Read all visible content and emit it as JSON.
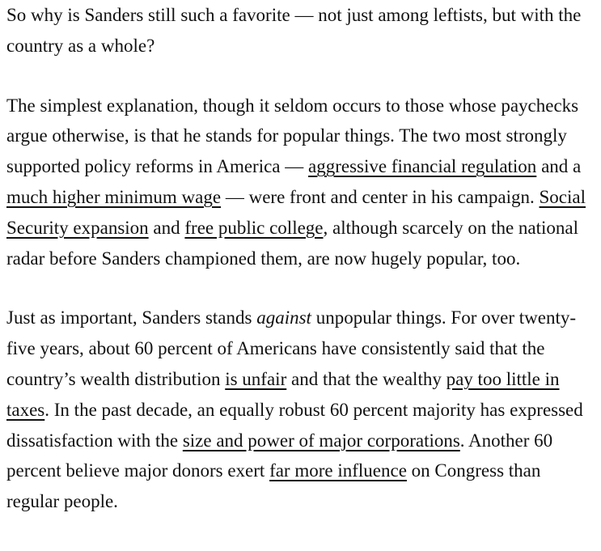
{
  "article": {
    "p1": {
      "text": "So why is Sanders still such a favorite — not just among leftists, but with the country as a whole?"
    },
    "p2": {
      "t1": "The simplest explanation, though it seldom occurs to those whose paychecks argue otherwise, is that he stands for popular things. The two most strongly supported policy reforms in America — ",
      "link1": "aggressive financial regulation",
      "t2": " and a ",
      "link2": "much higher minimum wage",
      "t3": " — were front and center in his campaign. ",
      "link3": "Social Security expansion",
      "t4": " and ",
      "link4": "free public college",
      "t5": ", although scarcely on the national radar before Sanders championed them, are now hugely popular, too."
    },
    "p3": {
      "t1": "Just as important, Sanders stands ",
      "em1": "against",
      "t2": " unpopular things. For over twenty-five years, about 60 percent of Americans have consistently said that the country’s wealth distribution ",
      "link1": "is unfair",
      "t3": " and that the wealthy ",
      "link2": "pay too little in taxes",
      "t4": ". In the past decade, an equally robust 60 percent majority has expressed dissatisfaction with the ",
      "link3": "size and power of major corporations",
      "t5": ". Another 60 percent believe major donors exert ",
      "link4": "far more influence",
      "t6": " on Congress than regular people."
    }
  }
}
